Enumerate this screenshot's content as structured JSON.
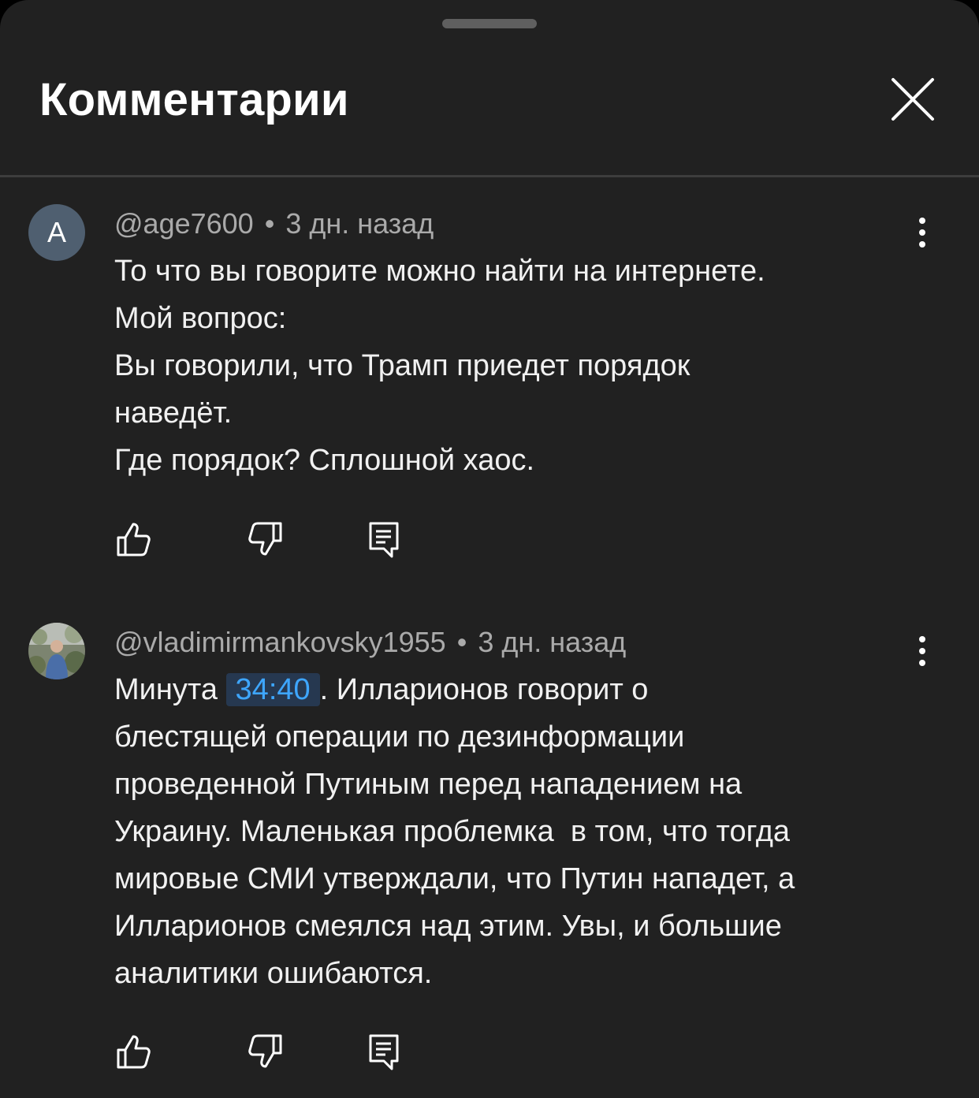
{
  "sheet": {
    "title": "Комментарии",
    "close_icon": "close-icon"
  },
  "comments": [
    {
      "avatar_letter": "A",
      "author": "@age7600",
      "separator": "•",
      "time": "3 дн. назад",
      "lines": [
        "То что вы говорите можно найти на интернете.",
        "Мой вопрос:",
        "Вы говорили, что Трамп приедет порядок",
        "наведёт.",
        "Где порядок? Сплошной хаос."
      ],
      "icons": [
        "like-icon",
        "dislike-icon",
        "reply-icon",
        "more-vert-icon"
      ]
    },
    {
      "avatar_description": "photo avatar",
      "author": "@vladimirmankovsky1955",
      "separator": "•",
      "time": "3 дн. назад",
      "first_line_prefix": "Минута ",
      "timestamp_link": "34:40",
      "first_line_suffix": ". Илларионов говорит о",
      "lines": [
        "блестящей операции по дезинформации",
        "проведенной Путиным перед нападением на",
        "Украину. Маленькая проблемка  в том, что тогда",
        "мировые СМИ утверждали, что Путин нападет, а",
        "Илларионов смеялся над этим. Увы, и большие",
        "аналитики ошибаются."
      ],
      "icons": [
        "like-icon",
        "dislike-icon",
        "reply-icon",
        "more-vert-icon"
      ]
    }
  ],
  "colors": {
    "background": "#212121",
    "text_primary": "#f1f1f1",
    "text_secondary": "#aaaaaa",
    "link": "#3ea6ff",
    "avatar_letter_bg": "#4f5f70"
  }
}
